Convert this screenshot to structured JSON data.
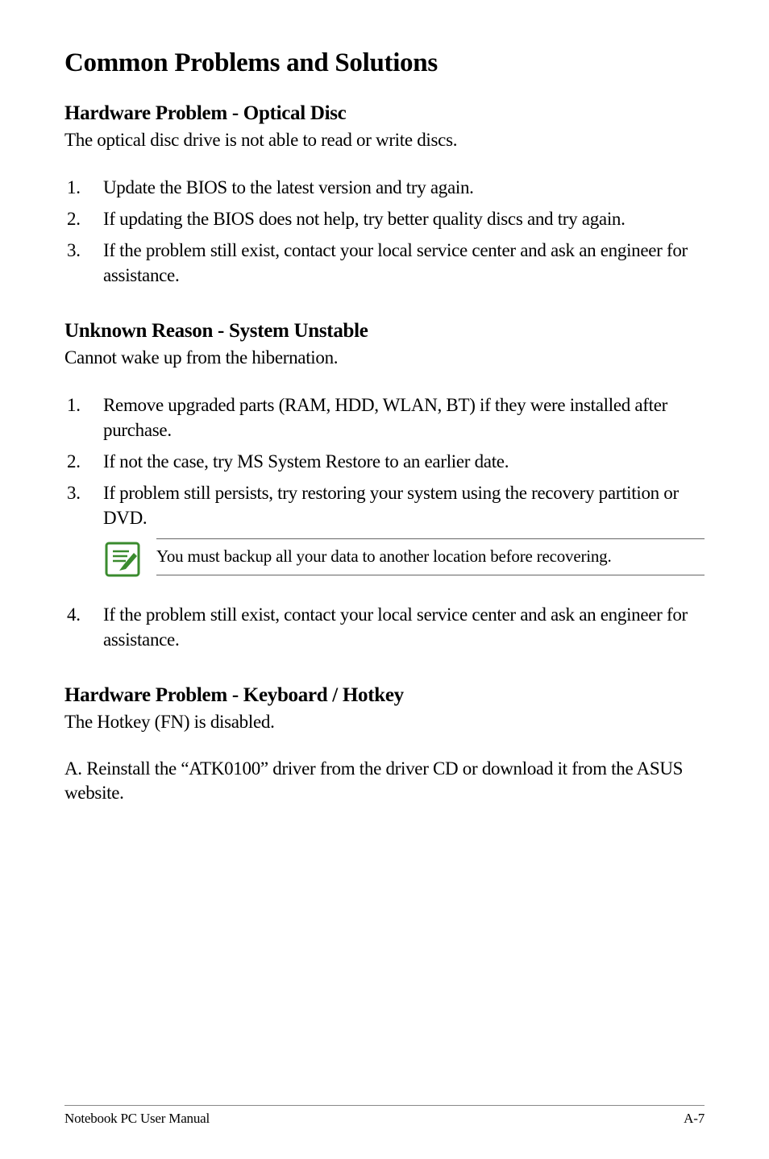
{
  "title": "Common Problems and Solutions",
  "sections": [
    {
      "heading": "Hardware Problem - Optical Disc",
      "intro": "The optical disc drive is not able to read or write discs.",
      "items": [
        "Update the BIOS to the latest version and try again.",
        "If updating the BIOS does not help, try better quality discs and try again.",
        "If the problem still exist, contact your local service center and ask an engineer for assistance."
      ]
    },
    {
      "heading": "Unknown Reason - System Unstable",
      "intro": "Cannot wake up from the hibernation.",
      "items": [
        "Remove upgraded parts (RAM, HDD, WLAN, BT) if they were installed after purchase.",
        "If not the case, try MS System Restore to an earlier date.",
        "If problem still persists, try restoring your system using the recovery partition or DVD."
      ],
      "note": "You must backup all your data to another location before recovering.",
      "post_items": [
        "If the problem still exist, contact your local service center and ask an engineer for assistance."
      ],
      "post_start": 4
    },
    {
      "heading": "Hardware Problem - Keyboard / Hotkey",
      "intro": "The Hotkey (FN) is disabled.",
      "body": "A. Reinstall the “ATK0100” driver from the driver CD or download it from the ASUS website."
    }
  ],
  "footer": {
    "left": "Notebook PC User Manual",
    "right": "A-7"
  }
}
